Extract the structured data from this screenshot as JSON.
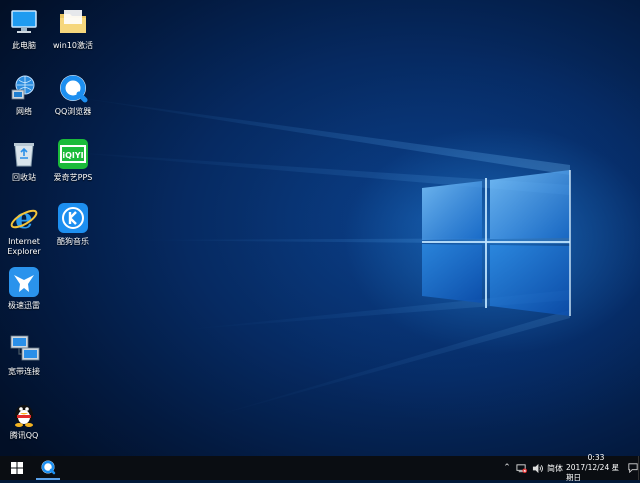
{
  "desktop_icons": [
    {
      "label": "此电脑",
      "icon": "this-pc-icon"
    },
    {
      "label": "win10激活",
      "icon": "folder-icon"
    },
    {
      "label": "网络",
      "icon": "network-icon"
    },
    {
      "label": "QQ浏览器",
      "icon": "qq-browser-icon"
    },
    {
      "label": "回收站",
      "icon": "recycle-bin-icon"
    },
    {
      "label": "爱奇艺PPS",
      "icon": "iqiyi-icon"
    },
    {
      "label": "Internet\nExplorer",
      "icon": "internet-explorer-icon"
    },
    {
      "label": "酷狗音乐",
      "icon": "kugou-music-icon"
    },
    {
      "label": "极速迅雷",
      "icon": "xunlei-icon"
    },
    {
      "label": "宽带连接",
      "icon": "broadband-connection-icon"
    },
    {
      "label": "腾讯QQ",
      "icon": "tencent-qq-icon"
    }
  ],
  "taskbar": {
    "start_icon": "windows-logo-icon",
    "pinned": [
      {
        "name": "qq-browser",
        "icon": "qq-browser-icon"
      }
    ],
    "tray": {
      "overflow_icon": "chevron-up-icon",
      "network_icon": "network-disconnected-icon",
      "volume_icon": "speaker-icon",
      "ime_label": "简体",
      "time": "0:33",
      "date": "2017/12/24 星期日",
      "notification_icon": "action-center-icon"
    }
  },
  "colors": {
    "accent_blue": "#2a8fe8",
    "taskbar_bg": "#0a0d12",
    "iqiyi_green": "#1bbb3a",
    "kugou_blue": "#1d8ff0"
  }
}
